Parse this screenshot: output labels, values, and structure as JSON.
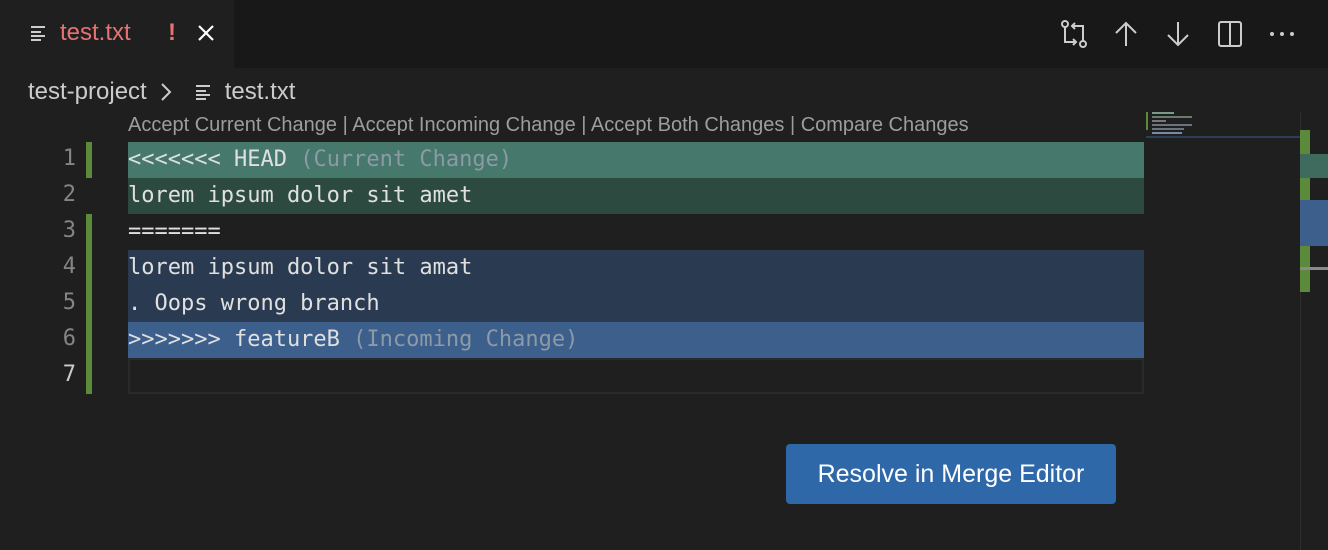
{
  "tab": {
    "label": "test.txt",
    "badge": "!",
    "file_icon": "file-text-icon",
    "close_icon": "close-icon"
  },
  "toolbar": {
    "icons": [
      "compare-changes-icon",
      "previous-change-icon",
      "next-change-icon",
      "split-editor-icon",
      "more-actions-icon"
    ]
  },
  "breadcrumb": {
    "project": "test-project",
    "file": "test.txt"
  },
  "codelens": {
    "accept_current": "Accept Current Change",
    "accept_incoming": "Accept Incoming Change",
    "accept_both": "Accept Both Changes",
    "compare": "Compare Changes",
    "separator": " | "
  },
  "editor": {
    "lines": [
      {
        "number": "1",
        "text": "<<<<<<< HEAD",
        "hint": " (Current Change)"
      },
      {
        "number": "2",
        "text": "lorem ipsum dolor sit amet",
        "hint": ""
      },
      {
        "number": "3",
        "text": "=======",
        "hint": ""
      },
      {
        "number": "4",
        "text": "lorem ipsum dolor sit amat",
        "hint": ""
      },
      {
        "number": "5",
        "text": ". Oops wrong branch",
        "hint": ""
      },
      {
        "number": "6",
        "text": ">>>>>>> featureB",
        "hint": " (Incoming Change)"
      },
      {
        "number": "7",
        "text": "",
        "hint": ""
      }
    ]
  },
  "resolve_button": {
    "label": "Resolve in Merge Editor"
  },
  "colors": {
    "current_header": "#46796b",
    "current_body": "#2c4a3f",
    "incoming_body": "#2a3a50",
    "incoming_header": "#3c5f8c",
    "button": "#2f68a8",
    "tab_modified": "#e57373"
  }
}
